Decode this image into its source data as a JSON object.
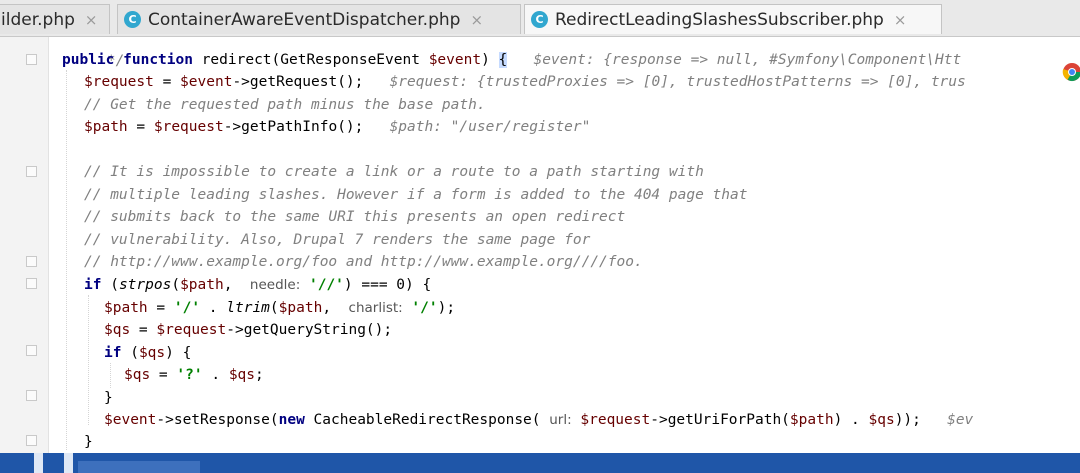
{
  "tabs": [
    {
      "label": "ilder.php",
      "icon": "",
      "active": false
    },
    {
      "label": "ContainerAwareEventDispatcher.php",
      "icon": "C",
      "active": false
    },
    {
      "label": "RedirectLeadingSlashesSubscriber.php",
      "icon": "C",
      "active": true
    }
  ],
  "tab_close": "×",
  "code": {
    "l0": "*/",
    "l1": [
      "public",
      "function",
      "redirect(GetResponseEvent ",
      "$event",
      ") ",
      "{",
      "   $event: {response => null, #Symfony\\Component\\Htt"
    ],
    "l2": [
      "$request",
      " = ",
      "$event",
      "->getRequest();   ",
      "$request: {trustedProxies => [0], trustedHostPatterns => [0], trus"
    ],
    "l3": "// Get the requested path minus the base path.",
    "l4": [
      "$path",
      " = ",
      "$request",
      "->getPathInfo();   ",
      "$path: \"/user/register\""
    ],
    "l6": "// It is impossible to create a link or a route to a path starting with",
    "l7": "// multiple leading slashes. However if a form is added to the 404 page that",
    "l8": "// submits back to the same URI this presents an open redirect",
    "l9": "// vulnerability. Also, Drupal 7 renders the same page for",
    "l10": "// http://www.example.org/foo and http://www.example.org////foo.",
    "l11": [
      "if",
      " (",
      "strpos",
      "(",
      "$path",
      ",  ",
      "needle:",
      " '//'",
      ") === 0) {"
    ],
    "l12": [
      "$path",
      " = ",
      "'/'",
      " . ",
      "ltrim",
      "(",
      "$path",
      ",  ",
      "charlist:",
      " '/'",
      ");"
    ],
    "l13": [
      "$qs",
      " = ",
      "$request",
      "->getQueryString();"
    ],
    "l14": [
      "if",
      " (",
      "$qs",
      ") {"
    ],
    "l15": [
      "$qs",
      " = ",
      "'?'",
      " . ",
      "$qs",
      ";"
    ],
    "l16": "}",
    "l17": [
      "$event",
      "->setResponse(",
      "new",
      " CacheableRedirectResponse( ",
      "url:",
      " $request",
      "->getUriForPath(",
      "$path",
      ") . ",
      "$qs",
      "));   ",
      "$ev"
    ],
    "l18": "}"
  }
}
